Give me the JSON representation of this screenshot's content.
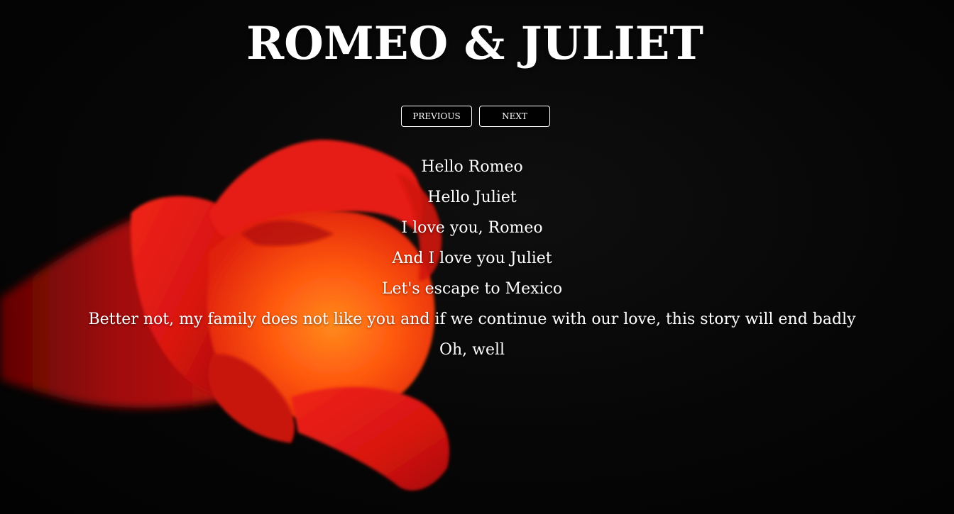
{
  "page": {
    "title": "ROMEO & JULIET"
  },
  "nav": {
    "previous_label": "PREVIOUS",
    "next_label": "NEXT"
  },
  "dialog": {
    "lines": [
      "Hello Romeo",
      "Hello Juliet",
      "I love you, Romeo",
      "And I love you Juliet",
      "Let's escape to Mexico",
      "Better not, my family does not like you and if we continue with our love, this story will end badly",
      "Oh, well"
    ]
  },
  "colors": {
    "background": "#050505",
    "text": "#ffffff",
    "flower_red": "#d4140c",
    "flower_orange": "#ff5a10"
  },
  "background_image": {
    "icon": "red-flower-image"
  }
}
